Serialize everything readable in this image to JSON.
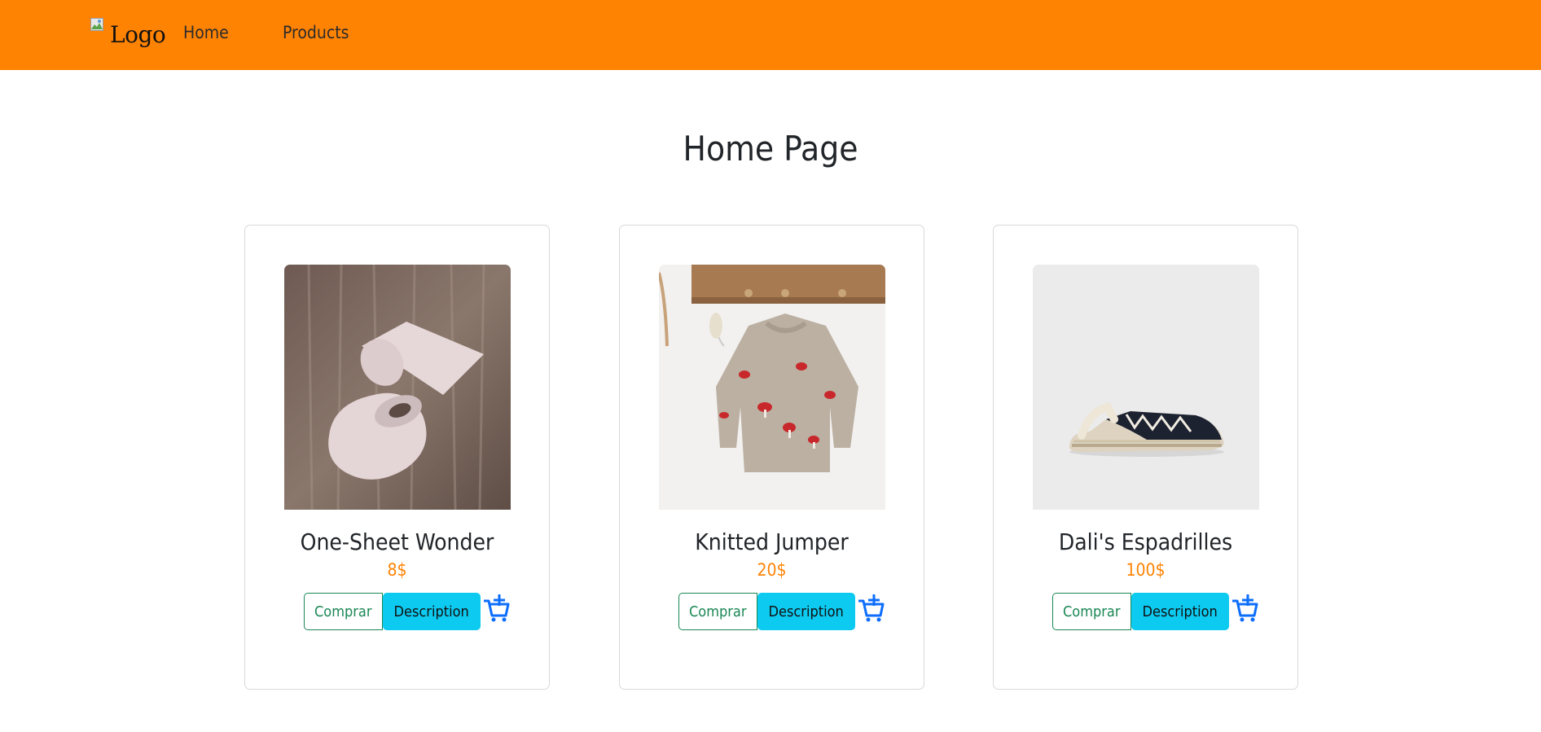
{
  "header": {
    "logo_alt": "Logo",
    "nav": [
      {
        "label": "Home"
      },
      {
        "label": "Products"
      }
    ]
  },
  "page_title": "Home Page",
  "products": [
    {
      "name": "One-Sheet Wonder",
      "price": "8$",
      "image": "toilet-paper-photo"
    },
    {
      "name": "Knitted Jumper",
      "price": "20$",
      "image": "knitted-sweater-photo"
    },
    {
      "name": "Dali's Espadrilles",
      "price": "100$",
      "image": "espadrille-shoe-photo"
    }
  ],
  "buttons": {
    "buy": "Comprar",
    "description": "Description",
    "cart_icon": "cart-plus-icon"
  },
  "colors": {
    "navbar": "#ff8303",
    "price": "#ff8303",
    "buy_outline": "#198754",
    "description_bg": "#0dcaf0",
    "cart_icon": "#0d6efd"
  }
}
